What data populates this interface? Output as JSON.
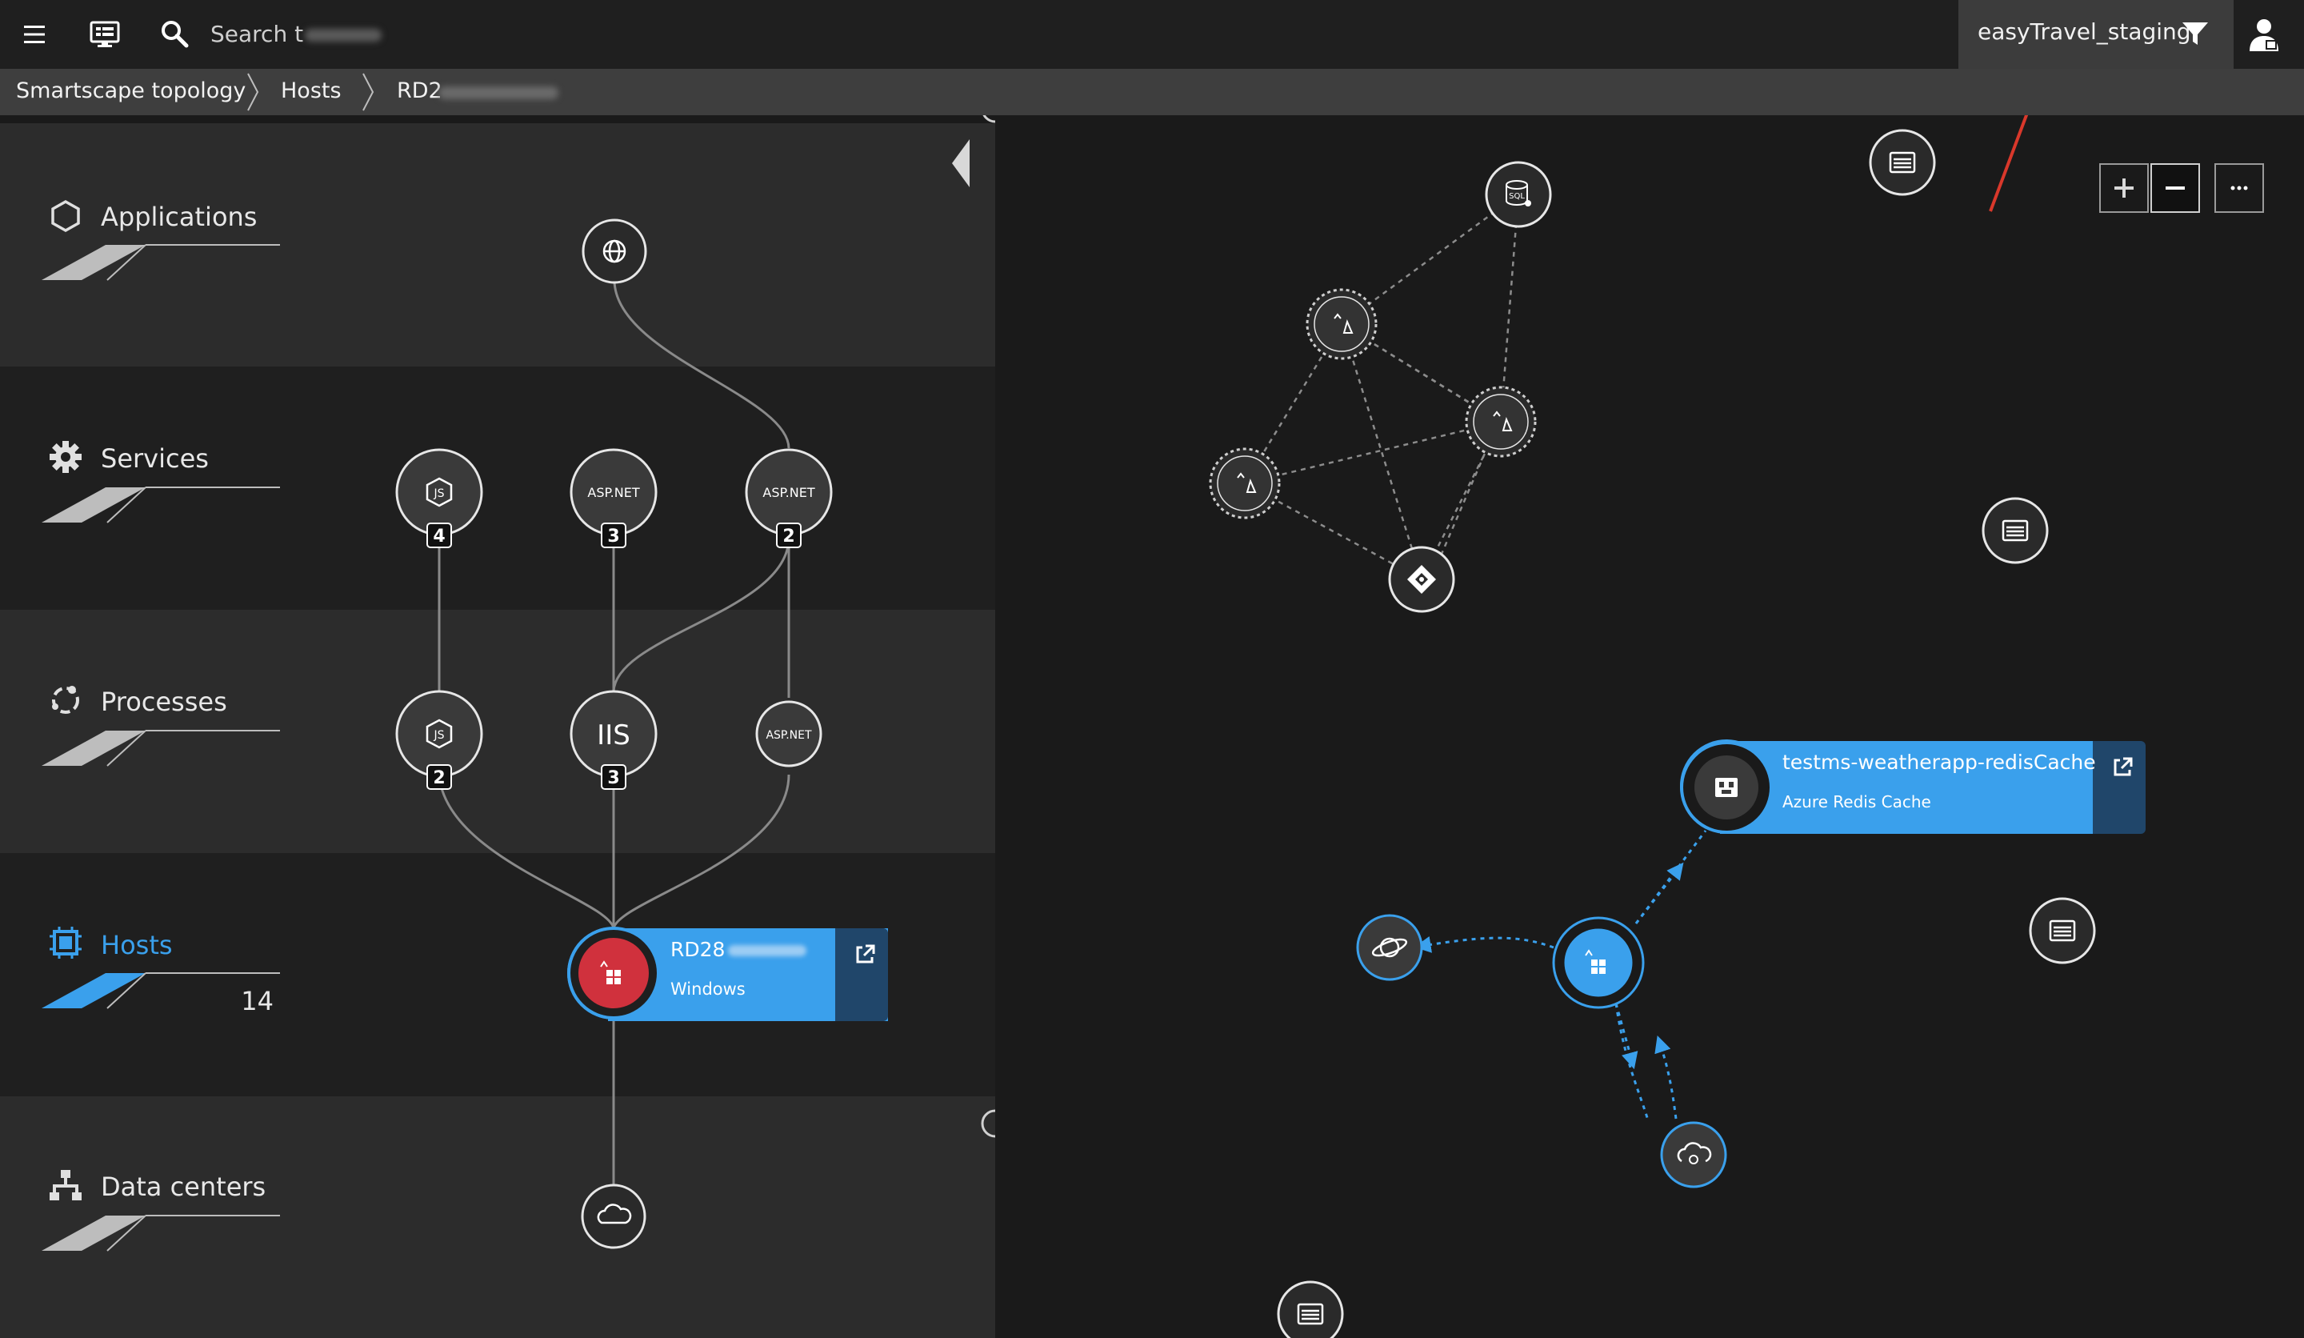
{
  "topbar": {
    "search_placeholder": "Search t",
    "environment_name": "easyTravel_staging"
  },
  "breadcrumb": {
    "items": [
      "Smartscape topology",
      "Hosts",
      "RD2"
    ]
  },
  "layers": {
    "applications": {
      "label": "Applications"
    },
    "services": {
      "label": "Services"
    },
    "processes": {
      "label": "Processes"
    },
    "hosts": {
      "label": "Hosts",
      "count": "14"
    },
    "datacenters": {
      "label": "Data centers"
    }
  },
  "nodes": {
    "services": [
      {
        "icon": "nodejs-icon",
        "label": "JS",
        "badge": "4"
      },
      {
        "icon": "aspnet-icon",
        "label": "ASP.NET",
        "badge": "3"
      },
      {
        "icon": "aspnet-icon",
        "label": "ASP.NET",
        "badge": "2"
      }
    ],
    "processes": [
      {
        "icon": "nodejs-icon",
        "label": "JS",
        "badge": "2"
      },
      {
        "icon": "iis-icon",
        "label": "IIS",
        "badge": "3"
      },
      {
        "icon": "aspnet-icon",
        "label": "ASP.NET"
      }
    ]
  },
  "host_card": {
    "title": "RD28",
    "subtitle": "Windows"
  },
  "redis_card": {
    "title": "testms-weatherapp-redisCache",
    "subtitle": "Azure Redis Cache"
  },
  "icons": {
    "sql": "SQL"
  },
  "colors": {
    "accent": "#3aa0ec",
    "card_ext": "#20466a",
    "host_red": "#d0313d",
    "annotation_arrow": "#d9382b"
  }
}
